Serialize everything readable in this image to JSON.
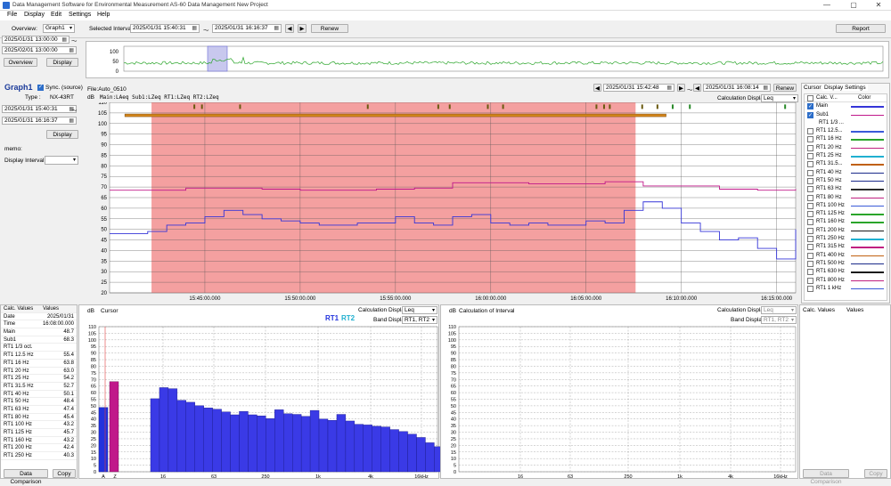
{
  "window": {
    "title": "Data Management Software for Environmental Measurement AS-60 Data Management New Project",
    "minimize": "—",
    "maximize": "▢",
    "close": "✕"
  },
  "menu": [
    "File",
    "Display",
    "Edit",
    "Settings",
    "Help"
  ],
  "toolbar": {
    "overview_label": "Overview:",
    "overview_value": "Graph1",
    "range_start": "2025/01/31 13:00:00",
    "range_end": "2025/02/01 13:00:00",
    "overview_btn": "Overview",
    "display_btn": "Display",
    "selected_interval_label": "Selected Interval:",
    "sel_start": "2025/01/31 15:40:31",
    "tilde": "〜",
    "sel_end": "2025/01/31 16:16:37",
    "renew": "Renew",
    "report": "Report"
  },
  "overview_chart": {
    "y_labels": [
      "100",
      "50",
      "0"
    ]
  },
  "left": {
    "graph": "Graph1",
    "sync_label": "Sync. (source)",
    "type_label": "Type :",
    "type_value": "NX-43RT",
    "start": "2025/01/31 15:40:31",
    "end": "2025/01/31 16:16:37",
    "display": "Display",
    "memo": "memo:",
    "interval_label": "Display Interval:"
  },
  "main_chart": {
    "file": "File:Auto_0510",
    "nav_start": "2025/01/31 15:42:48",
    "nav_end": "2025/01/31 16:08:14",
    "renew": "Renew",
    "unit": "dB",
    "legend": "Main:LAeq Sub1:LZeq RT1:LZeq RT2:LZeq",
    "calc_label": "Calculation Display",
    "calc_value": "Leq",
    "y_ticks": [
      "110",
      "105",
      "100",
      "95",
      "90",
      "85",
      "80",
      "75",
      "70",
      "65",
      "60",
      "55",
      "50",
      "45",
      "40",
      "35",
      "30",
      "25",
      "20"
    ],
    "x_ticks": [
      "15:45:00.000",
      "15:50:00.000",
      "15:55:00.000",
      "16:00:00.000",
      "16:05:00.000",
      "16:10:00.000",
      "16:15:00.000"
    ],
    "colors": {
      "main": "#3535d8",
      "sub1": "#c0188a",
      "selection": "#f08080",
      "bar": "#d4861a"
    }
  },
  "chart_data": [
    {
      "type": "line",
      "name": "time-history",
      "x_unit": "min since 15:40",
      "ylim": [
        20,
        110
      ],
      "series": [
        {
          "name": "Main",
          "x": [
            0,
            1,
            2,
            3,
            4,
            5,
            6,
            7,
            8,
            9,
            10,
            11,
            12,
            13,
            14,
            15,
            16,
            17,
            18,
            19,
            20,
            21,
            22,
            23,
            24,
            25,
            26,
            27,
            28,
            29,
            30,
            31,
            32,
            33,
            34,
            35,
            36
          ],
          "values": [
            48,
            48,
            49,
            52,
            53,
            56,
            59,
            57,
            55,
            54,
            53,
            52,
            52,
            53,
            53,
            56,
            53,
            52,
            56,
            57,
            53,
            52,
            53,
            52,
            52,
            54,
            53,
            59,
            63,
            60,
            53,
            49,
            45,
            46,
            41,
            36,
            50
          ]
        },
        {
          "name": "Sub1",
          "x": [
            0,
            2,
            4,
            6,
            8,
            10,
            12,
            14,
            16,
            18,
            20,
            22,
            24,
            26,
            28,
            30,
            32,
            34,
            36
          ],
          "values": [
            68.5,
            68.5,
            69.5,
            69.5,
            69,
            68.5,
            68.5,
            69,
            69.5,
            72,
            72,
            71.5,
            71.5,
            72.5,
            70.5,
            70.5,
            69,
            68.5,
            69
          ]
        }
      ]
    },
    {
      "type": "bar",
      "name": "cursor-spectrum",
      "ylim": [
        0,
        110
      ],
      "categories": [
        "A",
        "Z",
        "12.5",
        "16",
        "20",
        "25",
        "31.5",
        "40",
        "50",
        "63",
        "80",
        "100",
        "125",
        "160",
        "200",
        "250",
        "315",
        "400",
        "500",
        "630",
        "800",
        "1k",
        "1.25k",
        "1.6k",
        "2k",
        "2.5k",
        "3.15k",
        "4k",
        "5k",
        "6.3k",
        "8k",
        "10k",
        "12.5k",
        "16k",
        "20k"
      ],
      "series": [
        {
          "name": "RT1",
          "values": [
            48.7,
            68.3,
            55.4,
            63.8,
            63.0,
            54.2,
            52.7,
            50.1,
            48.4,
            47.4,
            45.4,
            43.2,
            45.7,
            43.2,
            42.4,
            40.3,
            47.0,
            44.0,
            43.5,
            42.0,
            46.5,
            40.0,
            39.0,
            43.5,
            38.5,
            36.0,
            35.5,
            34.5,
            34.0,
            32.0,
            30.5,
            28.5,
            26.0,
            22.0,
            19.0
          ]
        }
      ]
    }
  ],
  "cursor_panel": {
    "unit": "dB",
    "title": "Cursor",
    "rt1": "RT1",
    "rt2": "RT2",
    "calc_label": "Calculation Display",
    "calc_value": "Leq",
    "band_label": "Band Display",
    "band_value": "RT1, RT2",
    "x_labels": [
      "A",
      "Z",
      "16",
      "63",
      "250",
      "1k",
      "4k",
      "16kHz"
    ],
    "y_labels": [
      "110",
      "105",
      "100",
      "95",
      "90",
      "85",
      "80",
      "75",
      "70",
      "65",
      "60",
      "55",
      "50",
      "45",
      "40",
      "35",
      "30",
      "25",
      "20",
      "15",
      "10",
      "5",
      "0"
    ]
  },
  "interval_panel": {
    "unit": "dB",
    "title": "Calculation of Interval",
    "calc_label": "Calculation Display",
    "calc_value": "Leq",
    "band_label": "Band Display",
    "band_value": "RT1, RT2",
    "x_labels": [
      "16",
      "63",
      "250",
      "1k",
      "4k",
      "16kHz"
    ]
  },
  "values_table": {
    "header": [
      "Calc. Values",
      "Values"
    ],
    "rows": [
      [
        "Date",
        "2025/01/31"
      ],
      [
        "Time",
        "16:08:00.000"
      ],
      [
        "Main",
        "48.7"
      ],
      [
        "Sub1",
        "68.3"
      ],
      [
        "RT1 1/3 oct.",
        ""
      ],
      [
        "RT1 12.5 Hz",
        "55.4"
      ],
      [
        "RT1 16 Hz",
        "63.8"
      ],
      [
        "RT1 20 Hz",
        "63.0"
      ],
      [
        "RT1 25 Hz",
        "54.2"
      ],
      [
        "RT1 31.5 Hz",
        "52.7"
      ],
      [
        "RT1 40 Hz",
        "50.1"
      ],
      [
        "RT1 50 Hz",
        "48.4"
      ],
      [
        "RT1 63 Hz",
        "47.4"
      ],
      [
        "RT1 80 Hz",
        "45.4"
      ],
      [
        "RT1 100 Hz",
        "43.2"
      ],
      [
        "RT1 125 Hz",
        "45.7"
      ],
      [
        "RT1 160 Hz",
        "43.2"
      ],
      [
        "RT1 200 Hz",
        "42.4"
      ],
      [
        "RT1 250 Hz",
        "40.3"
      ]
    ],
    "compare": "Data Comparison",
    "copy": "Copy"
  },
  "right_table": {
    "header": [
      "Calc. Values",
      "Values"
    ],
    "compare": "Data Comparison",
    "copy": "Copy"
  },
  "display_settings": {
    "tabs": [
      "Cursor",
      "Display Settings"
    ],
    "header": [
      "Calc. V...",
      "Color"
    ],
    "rows": [
      {
        "name": "Main",
        "on": true,
        "color": ""
      },
      {
        "name": "Sub1",
        "on": true,
        "color": ""
      },
      {
        "name": "RT1 1/3 ...",
        "on": null,
        "color": ""
      },
      {
        "name": "RT1 12.5...",
        "on": false,
        "color": "#3a5ad8"
      },
      {
        "name": "RT1 16 Hz",
        "on": false,
        "color": "#2aa52a"
      },
      {
        "name": "RT1 20 Hz",
        "on": false,
        "color": "#c02080"
      },
      {
        "name": "RT1 25 Hz",
        "on": false,
        "color": "#20b0d0"
      },
      {
        "name": "RT1 31.5...",
        "on": false,
        "color": "#c06010"
      },
      {
        "name": "RT1 40 Hz",
        "on": false,
        "color": "#1a2a8a"
      },
      {
        "name": "RT1 50 Hz",
        "on": false,
        "color": "#1a2a8a"
      },
      {
        "name": "RT1 63 Hz",
        "on": false,
        "color": "#2a2a2a"
      },
      {
        "name": "RT1 80 Hz",
        "on": false,
        "color": "#c02080"
      },
      {
        "name": "RT1 100 Hz",
        "on": false,
        "color": "#3a5ad8"
      },
      {
        "name": "RT1 125 Hz",
        "on": false,
        "color": "#2aa52a"
      },
      {
        "name": "RT1 160 Hz",
        "on": false,
        "color": "#2aa52a"
      },
      {
        "name": "RT1 200 Hz",
        "on": false,
        "color": "#1a1a1a"
      },
      {
        "name": "RT1 250 Hz",
        "on": false,
        "color": "#20b0d0"
      },
      {
        "name": "RT1 315 Hz",
        "on": false,
        "color": "#c02080"
      },
      {
        "name": "RT1 400 Hz",
        "on": false,
        "color": "#c06010"
      },
      {
        "name": "RT1 500 Hz",
        "on": false,
        "color": "#1a2a8a"
      },
      {
        "name": "RT1 630 Hz",
        "on": false,
        "color": "#1a1a1a"
      },
      {
        "name": "RT1 800 Hz",
        "on": false,
        "color": "#c02080"
      },
      {
        "name": "RT1 1 kHz",
        "on": false,
        "color": "#3a5ad8"
      }
    ]
  }
}
